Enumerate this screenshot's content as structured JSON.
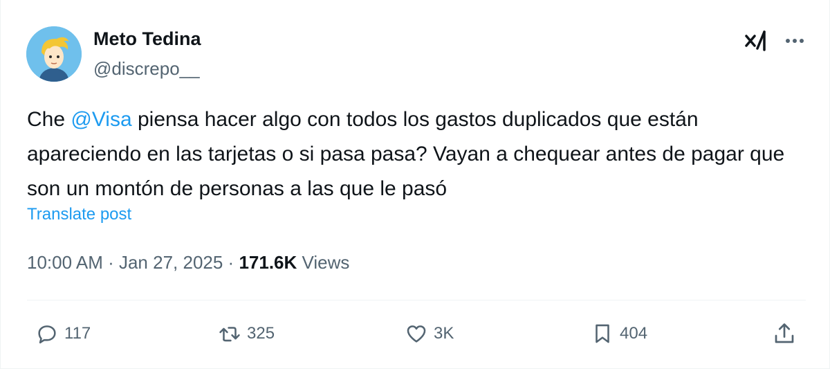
{
  "author": {
    "name": "Meto Tedina",
    "handle": "@discrepo__"
  },
  "post": {
    "text_before": "Che ",
    "mention": "@Visa",
    "text_after": " piensa hacer algo con todos los gastos duplicados que están apareciendo en las tarjetas o si pasa pasa? Vayan a chequear antes de pagar que son un montón de personas a las que le pasó",
    "translate_label": "Translate post"
  },
  "meta": {
    "time": "10:00 AM",
    "separator": " · ",
    "date": "Jan 27, 2025",
    "views_count": "171.6K",
    "views_label": " Views"
  },
  "actions": {
    "replies": "117",
    "reposts": "325",
    "likes": "3K",
    "bookmarks": "404"
  },
  "colors": {
    "accent": "#1d9bf0",
    "primary_text": "#0f1419",
    "secondary_text": "#536471",
    "border": "#eff3f4"
  },
  "icons": [
    "grok-icon",
    "more-icon",
    "reply-icon",
    "repost-icon",
    "like-icon",
    "bookmark-icon",
    "share-icon"
  ]
}
